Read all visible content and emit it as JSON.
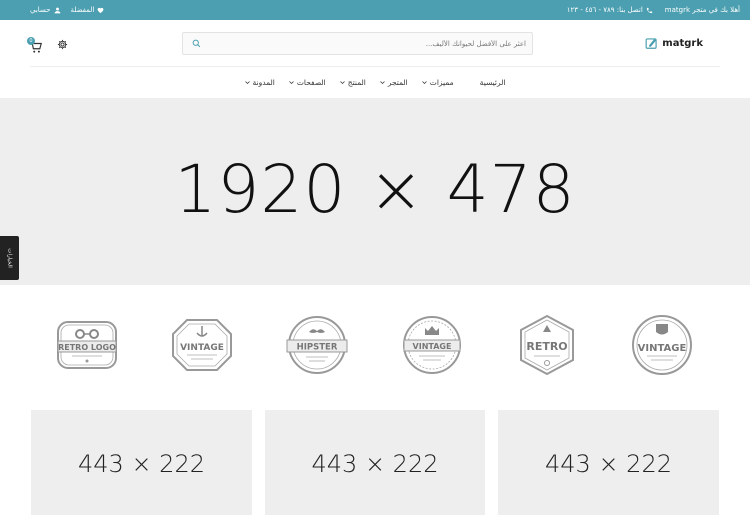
{
  "topbar": {
    "welcome": "أهلا بك في متجر matgrk",
    "contact": "اتصل بنا: ٧٨٩ - ٤٥٦ - ١٢٣",
    "wishlist": "المفضلة",
    "account": "حسابي",
    "background": "#4b9fb0"
  },
  "header": {
    "logo_text": "matgrk",
    "search_placeholder": "اعثر على الأفضل لحيوانك الأليف...",
    "cart_count": "0"
  },
  "nav": {
    "items": [
      {
        "label": "الرئيسية"
      },
      {
        "label": "مميزات"
      },
      {
        "label": "المتجر"
      },
      {
        "label": "المنتج"
      },
      {
        "label": "الصفحات"
      },
      {
        "label": "المدونة"
      }
    ]
  },
  "hero": {
    "placeholder": "1920 × 478"
  },
  "side_tab": {
    "label": "الخيارات"
  },
  "brands": [
    {
      "label": "RETRO LOGO"
    },
    {
      "label": "VINTAGE"
    },
    {
      "label": "HIPSTER"
    },
    {
      "label": "VINTAGE"
    },
    {
      "label": "RETRO"
    },
    {
      "label": "VINTAGE"
    }
  ],
  "banners": [
    {
      "placeholder": "443 × 222"
    },
    {
      "placeholder": "443 × 222"
    },
    {
      "placeholder": "443 × 222"
    }
  ]
}
